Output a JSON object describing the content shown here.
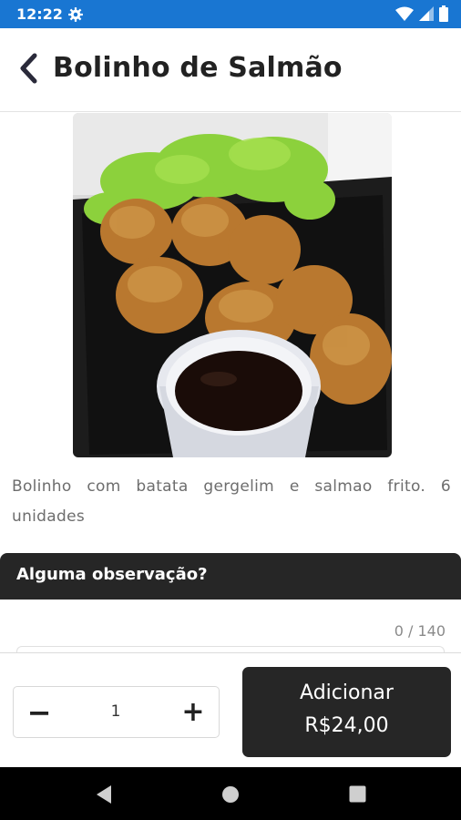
{
  "status_bar": {
    "time": "12:22",
    "icons": [
      "gear-icon",
      "wifi-icon",
      "signal-icon",
      "battery-icon"
    ],
    "color": "#1976d2"
  },
  "header": {
    "title": "Bolinho de Salmão"
  },
  "product": {
    "description": "Bolinho com batata gergelim e salmao frito. 6 unidades"
  },
  "observation": {
    "label": "Alguma observação?",
    "counter": "0 / 140",
    "value": ""
  },
  "order": {
    "quantity": "1",
    "minus_label": "−",
    "plus_label": "+",
    "add_label": "Adicionar",
    "price": "R$24,00"
  },
  "nav_bar": {
    "icons": [
      "nav-back-icon",
      "nav-home-icon",
      "nav-recents-icon"
    ]
  },
  "colors": {
    "dark": "#262626",
    "status_blue": "#1976d2"
  }
}
